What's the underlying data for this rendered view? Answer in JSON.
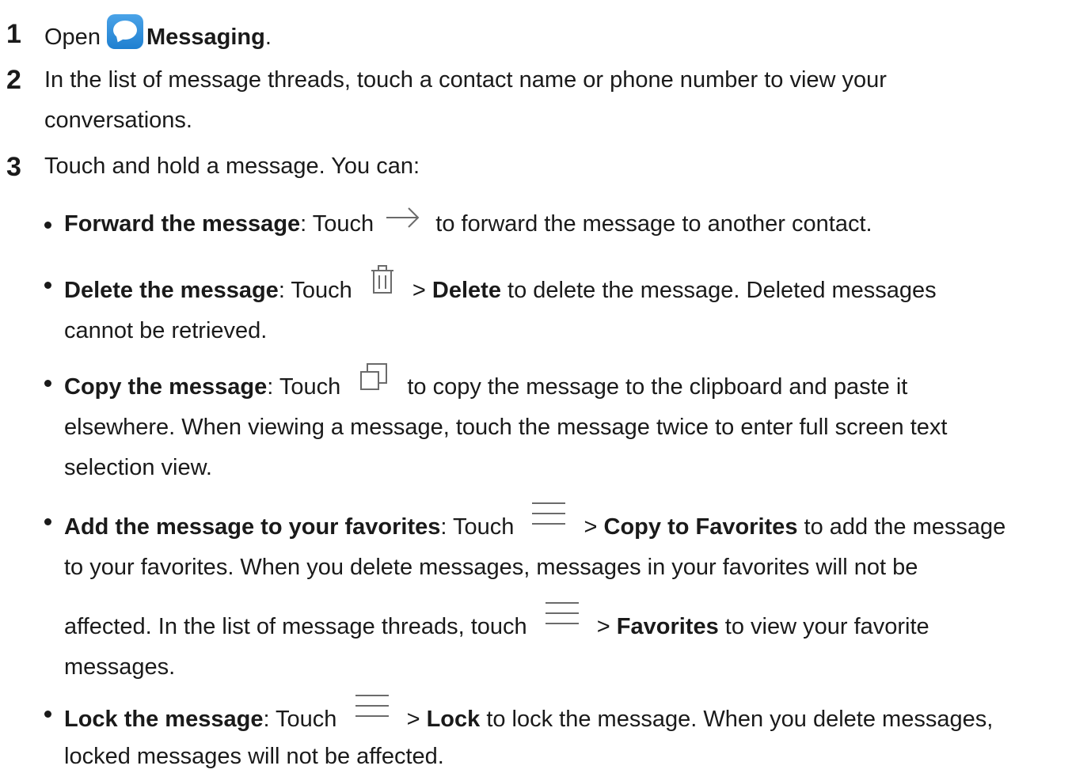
{
  "steps": [
    {
      "num": "1",
      "parts": [
        "Open",
        "Messaging",
        "."
      ]
    },
    {
      "num": "2",
      "line1": "In the list of message threads, touch a contact name or phone number to view your",
      "line2": "conversations."
    },
    {
      "num": "3",
      "text": "Touch and hold a message. You can:"
    }
  ],
  "bullets": {
    "forward": {
      "title": "Forward the message",
      "pre": ": Touch",
      "post": "to forward the message to another contact."
    },
    "delete": {
      "title": "Delete the message",
      "pre": ": Touch",
      "sep": ">",
      "action": "Delete",
      "post": "to delete the message. Deleted messages",
      "line2": "cannot be retrieved."
    },
    "copy": {
      "title": "Copy the message",
      "pre": ": Touch",
      "post": "to copy the message to the clipboard and paste it",
      "line2": "elsewhere. When viewing a message, touch the message twice to enter full screen text",
      "line3": "selection view."
    },
    "favorites": {
      "title": "Add the message to your favorites",
      "pre": ": Touch",
      "sep": ">",
      "action": "Copy to Favorites",
      "post": "to add the message",
      "line2": "to your favorites. When you delete messages, messages in your favorites will not be",
      "line3_pre": "affected. In the list of message threads, touch",
      "line3_sep": ">",
      "line3_action": "Favorites",
      "line3_post": "to view your favorite",
      "line4": "messages."
    },
    "lock": {
      "title": "Lock the message",
      "pre": ": Touch",
      "sep": ">",
      "action": "Lock",
      "post": "to lock the message. When you delete messages,",
      "line2": "locked messages will not be affected."
    }
  },
  "icons": {
    "messaging_app": "messaging-app-icon",
    "forward": "forward-arrow-icon",
    "delete": "trash-icon",
    "copy": "copy-icon",
    "menu": "menu-icon"
  },
  "colors": {
    "text": "#1a1a1a",
    "icon_stroke": "#6b6b6b",
    "messaging_icon": "#2b8be0"
  }
}
